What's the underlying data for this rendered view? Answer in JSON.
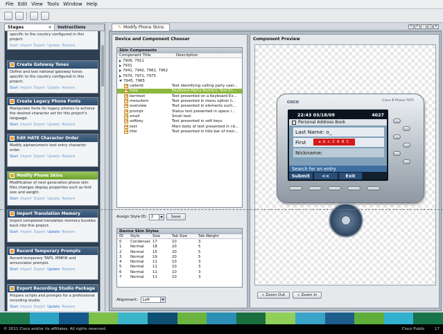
{
  "menu": [
    "File",
    "Edit",
    "View",
    "Tools",
    "Window",
    "Help"
  ],
  "left_tabs": {
    "stages": "Stages",
    "instructions": "Instructions"
  },
  "stage_partial_desc": "specific to the country configured in this project.",
  "stage_links": [
    "Start",
    "Import",
    "Export",
    "Update",
    "Restore"
  ],
  "stages": [
    {
      "title": "Create Gateway Tones",
      "desc": "Define and test national gateway tones specific to the country configured in this project."
    },
    {
      "title": "Create Legacy Phone Fonts",
      "desc": "Manipulate fonts for legacy phones to achieve the desired character set for this project's language."
    },
    {
      "title": "Edit HATE Character Order",
      "desc": "Modify alphanumeric text entry character order."
    },
    {
      "title": "Modify Phone Skins",
      "desc": "Modification of next generation phone skin files changes display properties such as font size and weight.",
      "active": true
    },
    {
      "title": "Import Translation Memory",
      "desc": "Import completed translation memory bundles back into this project."
    },
    {
      "title": "Record Temporary Prompts",
      "desc": "Record temporary TAPS, MMP/R and annunciator prompts."
    },
    {
      "title": "Export Recording Studio Package",
      "desc": "Prepare scripts and prompts for a professional recording studio."
    }
  ],
  "doc_tab": "Modify Phone Skins",
  "doc_nav": [
    "<",
    ">",
    "–",
    "□",
    "×"
  ],
  "chooser": {
    "title": "Device and Component Chooser",
    "skin_components": {
      "title": "Skin Components",
      "col_title": "Component Title",
      "col_desc": "Description",
      "groups": [
        "7906, 7911",
        "7931",
        "7941, 7942, 7961, 7962",
        "7970, 7971, 7975",
        "7945, 7965"
      ],
      "items": [
        {
          "name": "callerid",
          "desc": "Text identifying calling party user..."
        },
        {
          "name": "hate",
          "desc": "Keyboard Alpha Numeric Text En...",
          "selected": true
        },
        {
          "name": "kerntext",
          "desc": "Text presented on a Keyboard Ex..."
        },
        {
          "name": "menuitem",
          "desc": "Text presented in menu option li..."
        },
        {
          "name": "overview",
          "desc": "Text presented in elements such..."
        },
        {
          "name": "prompt",
          "desc": "Status text presented in space i..."
        },
        {
          "name": "small",
          "desc": "Small text."
        },
        {
          "name": "softkey",
          "desc": "Text presented in soft keys."
        },
        {
          "name": "text",
          "desc": "Main body of text presented in i-b..."
        },
        {
          "name": "title",
          "desc": "Text presented in title bar of men..."
        }
      ]
    },
    "assign_label": "Assign Style ID:",
    "assign_value": "2",
    "save_label": "Save",
    "styles": {
      "title": "Device Skin Styles",
      "headers": [
        "ID",
        "Style",
        "Size",
        "Tab Size",
        "Tab Weight"
      ],
      "rows": [
        [
          "0",
          "Condensed",
          "17",
          "10",
          "3"
        ],
        [
          "1",
          "Normal",
          "18",
          "20",
          "5"
        ],
        [
          "2",
          "Normal",
          "15",
          "20",
          "5"
        ],
        [
          "3",
          "Normal",
          "19",
          "20",
          "5"
        ],
        [
          "4",
          "Normal",
          "11",
          "10",
          "3"
        ],
        [
          "5",
          "Normal",
          "11",
          "10",
          "3"
        ],
        [
          "6",
          "Normal",
          "11",
          "10",
          "3"
        ],
        [
          "7",
          "Normal",
          "11",
          "10",
          "3"
        ]
      ]
    },
    "alignment_label": "Alignment:",
    "alignment_value": "Left"
  },
  "preview": {
    "title": "Component Preview",
    "brand": "CISCO",
    "model": "Cisco IP Phone 7975",
    "time": "22:43 03/18/09",
    "ext": "4027",
    "screen_title": "Personal Address Book",
    "field1": "Last Name: o_",
    "field2": "First",
    "keyboard": "a b c 2 A B C",
    "field3": "Nickname:",
    "prompt": "Search for an entry",
    "softkeys": [
      "Submit",
      "<<",
      "Exit"
    ],
    "zoom_out": "Zoom Out",
    "zoom_in": "Zoom In"
  },
  "footer": {
    "copyright": "© 2011 Cisco and/or its affiliates. All rights reserved.",
    "classification": "Cisco Public",
    "page": "17"
  },
  "colors": {
    "footer_strip": [
      "#1f7a4f",
      "#2fa3c4",
      "#155a8a",
      "#7cc04a",
      "#3bb5c9",
      "#0e4f72",
      "#6bb43f",
      "#2c8fb5",
      "#1b6f3e",
      "#8fcf5a",
      "#3aa3c8",
      "#1d5e8c",
      "#5fae3a",
      "#31b0cf",
      "#17734a"
    ]
  }
}
